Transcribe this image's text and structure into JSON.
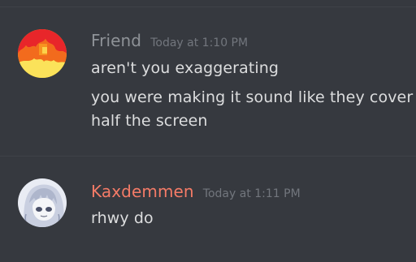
{
  "messages": [
    {
      "username": "Friend",
      "username_color": "#8e9297",
      "timestamp": "Today at 1:10 PM",
      "avatar": "flame-avatar",
      "lines": [
        "aren't you exaggerating",
        "you were making it sound like they cover",
        "half the screen"
      ]
    },
    {
      "username": "Kaxdemmen",
      "username_color": "#f47b67",
      "timestamp": "Today at 1:11 PM",
      "avatar": "anime-character-avatar",
      "lines": [
        "rhwy do"
      ]
    }
  ],
  "colors": {
    "background": "#36393f",
    "message_text": "#dcddde",
    "timestamp": "#72767d",
    "divider": "#3f4248"
  }
}
